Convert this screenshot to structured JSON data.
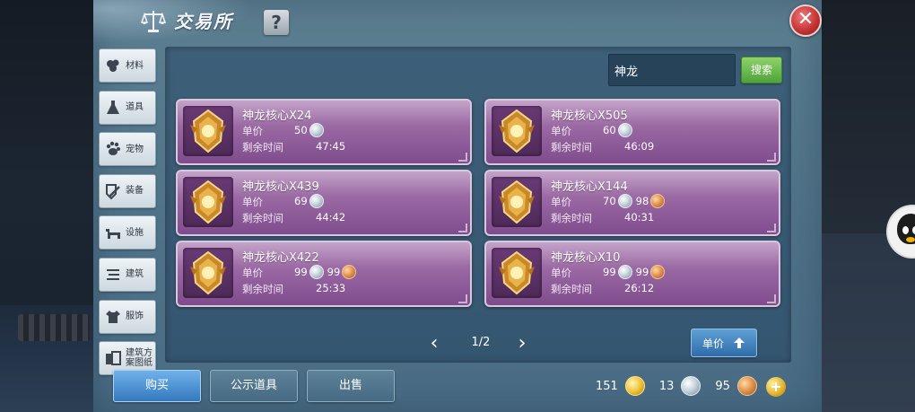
{
  "header": {
    "title": "交易所",
    "help_label": "?",
    "close_label": "✕"
  },
  "sidebar": {
    "items": [
      {
        "label": "材料",
        "icon": "materials-icon"
      },
      {
        "label": "道具",
        "icon": "potion-icon"
      },
      {
        "label": "宠物",
        "icon": "paw-icon"
      },
      {
        "label": "装备",
        "icon": "equipment-icon"
      },
      {
        "label": "设施",
        "icon": "facility-icon"
      },
      {
        "label": "建筑",
        "icon": "building-icon"
      },
      {
        "label": "服饰",
        "icon": "clothing-icon"
      },
      {
        "label": "建筑方案图纸",
        "icon": "blueprint-icon"
      }
    ]
  },
  "search": {
    "value": "神龙",
    "button_label": "搜索"
  },
  "listings": {
    "price_label": "单价",
    "time_label": "剩余时间",
    "items": [
      {
        "name": "神龙核心X24",
        "silver": "50",
        "copper": "",
        "time": "47:45"
      },
      {
        "name": "神龙核心X505",
        "silver": "60",
        "copper": "",
        "time": "46:09"
      },
      {
        "name": "神龙核心X439",
        "silver": "69",
        "copper": "",
        "time": "44:42"
      },
      {
        "name": "神龙核心X144",
        "silver": "70",
        "copper": "98",
        "time": "40:31"
      },
      {
        "name": "神龙核心X422",
        "silver": "99",
        "copper": "99",
        "time": "25:33"
      },
      {
        "name": "神龙核心X10",
        "silver": "99",
        "copper": "99",
        "time": "26:12"
      }
    ]
  },
  "pagination": {
    "prev": "‹",
    "next": "›",
    "page": "1/2"
  },
  "sort": {
    "label": "单价",
    "icon": "sort-arrow-icon"
  },
  "tabs": [
    {
      "label": "购买",
      "active": true
    },
    {
      "label": "公示道具",
      "active": false
    },
    {
      "label": "出售",
      "active": false
    }
  ],
  "wallet": {
    "gold": "151",
    "silver": "13",
    "copper": "95",
    "add_label": "+"
  },
  "colors": {
    "card_purple": "#9b6aa4",
    "search_green": "#4ea43a",
    "tab_active_blue": "#3478be",
    "close_red": "#c23030"
  }
}
